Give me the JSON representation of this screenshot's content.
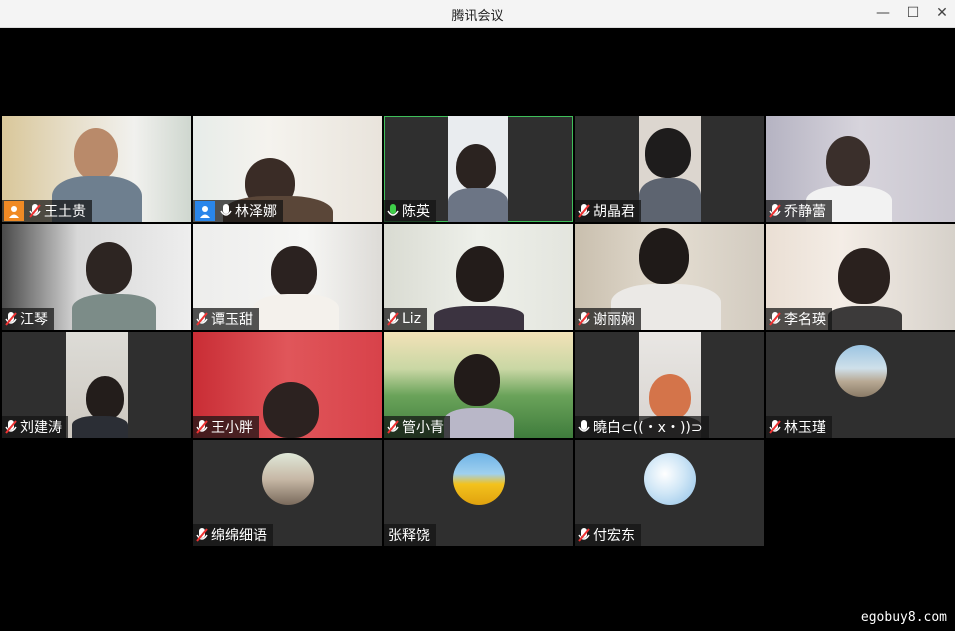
{
  "window": {
    "title": "腾讯会议"
  },
  "participants": [
    {
      "name": "王土贵",
      "mic": "muted",
      "badge": "orange"
    },
    {
      "name": "林泽娜",
      "mic": "on",
      "badge": "blue"
    },
    {
      "name": "陈英",
      "mic": "speaking"
    },
    {
      "name": "胡晶君",
      "mic": "muted"
    },
    {
      "name": "乔静蕾",
      "mic": "muted"
    },
    {
      "name": "江琴",
      "mic": "muted"
    },
    {
      "name": "谭玉甜",
      "mic": "muted"
    },
    {
      "name": "Liz",
      "mic": "muted"
    },
    {
      "name": "谢丽娴",
      "mic": "muted"
    },
    {
      "name": "李名瑛",
      "mic": "muted"
    },
    {
      "name": "刘建涛",
      "mic": "muted"
    },
    {
      "name": "王小胖",
      "mic": "muted"
    },
    {
      "name": "管小青",
      "mic": "muted"
    },
    {
      "name": "曉白⊂((・x・))⊃",
      "mic": "on"
    },
    {
      "name": "林玉瑾",
      "mic": "muted"
    },
    {
      "name": "绵绵细语",
      "mic": "muted"
    },
    {
      "name": "张释饶",
      "mic": "none"
    },
    {
      "name": "付宏东",
      "mic": "muted"
    }
  ],
  "watermark": "egobuy8.com"
}
